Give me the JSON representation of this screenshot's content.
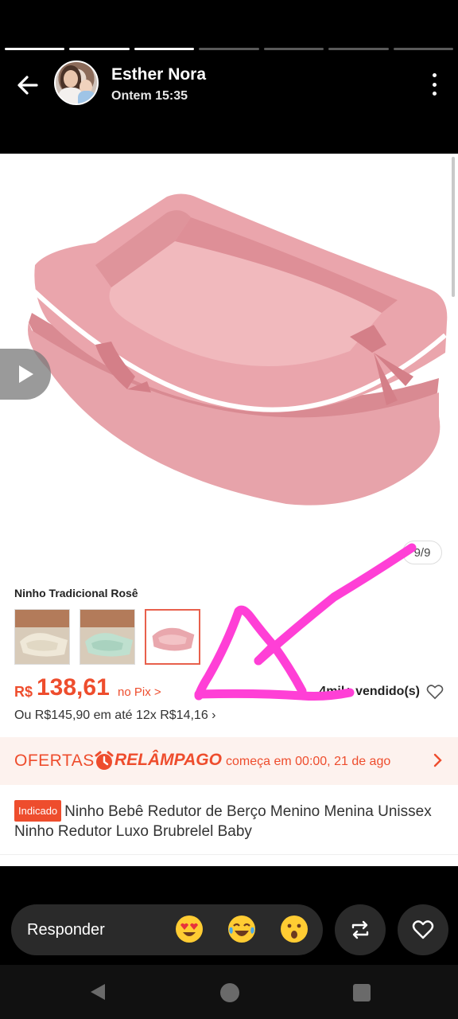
{
  "story": {
    "segments_total": 7,
    "segments_viewed": 3,
    "user_name": "Esther Nora",
    "timestamp": "Ontem 15:35"
  },
  "product": {
    "image_counter": "9/9",
    "variant_title": "Ninho Tradicional Rosê",
    "thumbnails": [
      {
        "name": "thumbnail-cream",
        "color": "#efe8d8"
      },
      {
        "name": "thumbnail-green",
        "color": "#bfe0cf"
      },
      {
        "name": "thumbnail-pink",
        "color": "#e9a7ad",
        "selected": true
      }
    ],
    "currency": "R$",
    "price": "138,61",
    "pix_label": "no Pix >",
    "sold_label": "4mil+ vendido(s)",
    "installments": "Ou R$145,90 em até 12x R$14,16 ›",
    "flash": {
      "ofertas": "OFERTAS",
      "relampago": "RELÂMPAGO",
      "when": "começa em 00:00, 21 de ago"
    },
    "badge": "Indicado",
    "title": "Ninho Bebê Redutor de Berço Menino Menina Unissex Ninho Redutor Luxo Brubrelel Baby"
  },
  "reply": {
    "placeholder": "Responder",
    "emojis": [
      "heart-eyes",
      "tears-of-joy",
      "surprised"
    ]
  },
  "colors": {
    "accent": "#ee4d2d",
    "annotation": "#ff3fd6"
  }
}
